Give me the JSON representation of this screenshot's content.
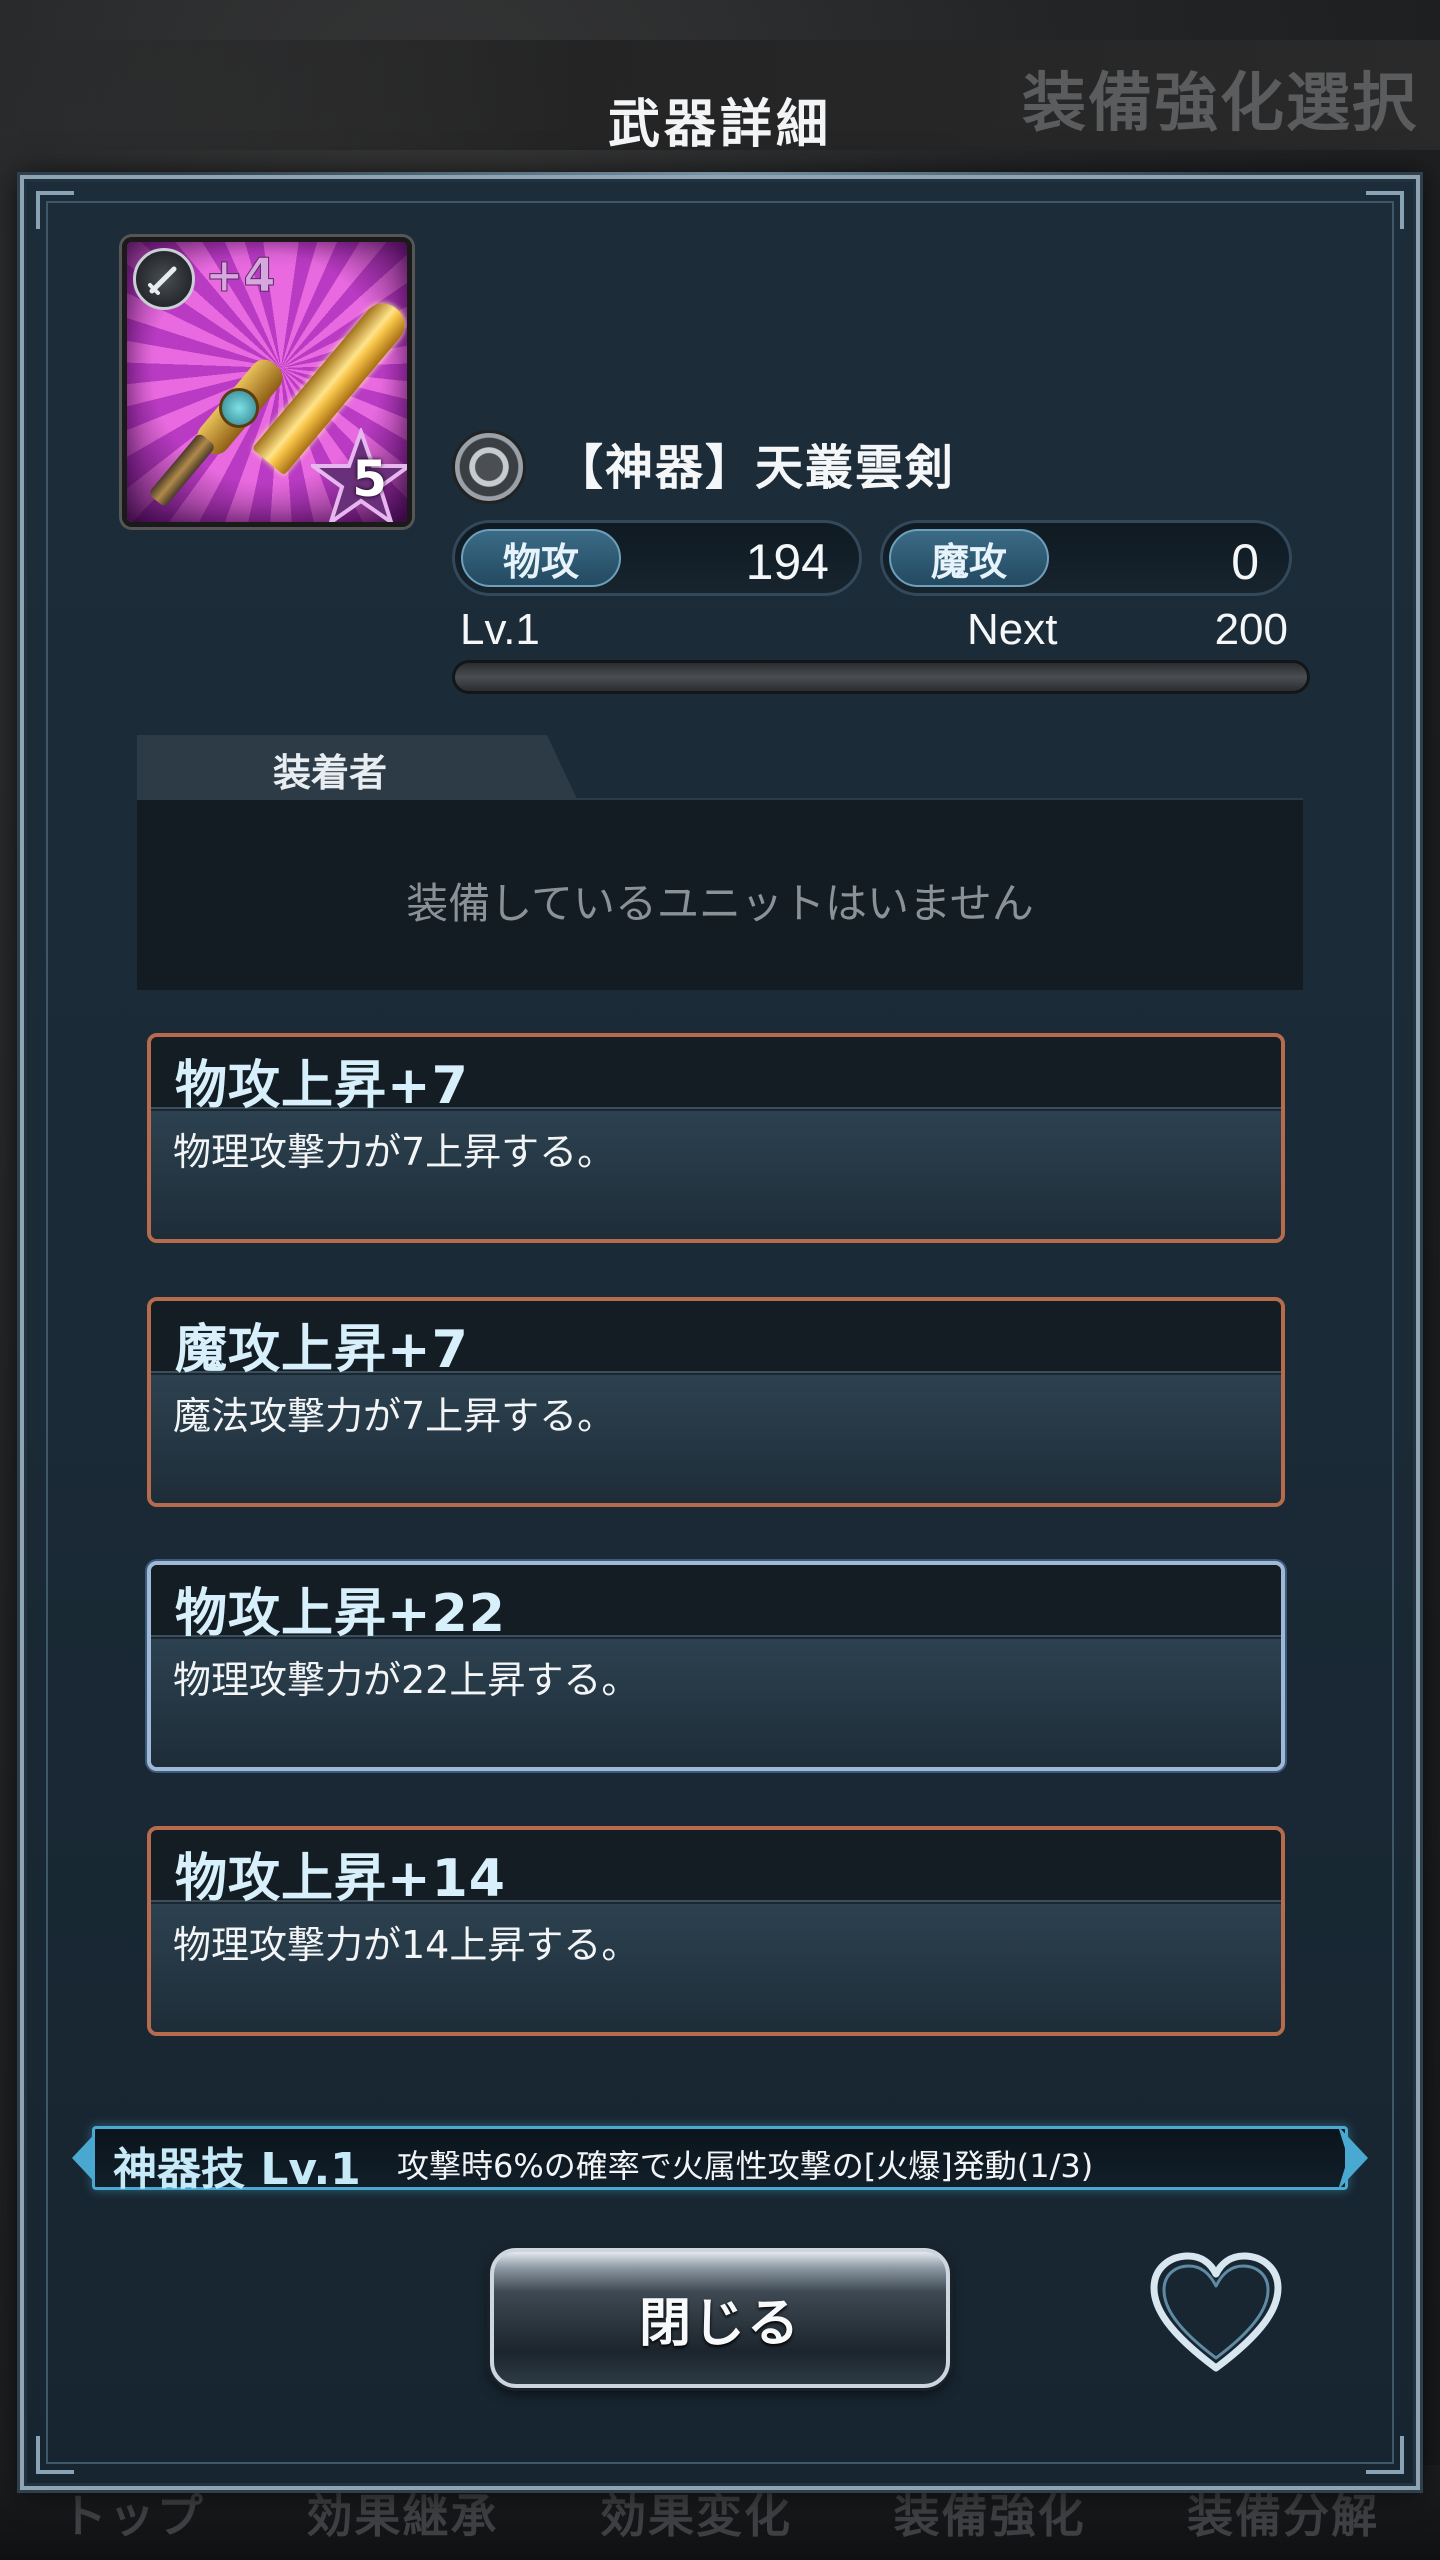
{
  "background": {
    "title": "装備強化選択",
    "nav": [
      "トップ",
      "効果継承",
      "効果変化",
      "装備強化",
      "装備分解"
    ]
  },
  "modal": {
    "title": "武器詳細"
  },
  "weapon": {
    "name": "【神器】天叢雲剣",
    "plus": "+4",
    "rarity": "5",
    "type_icon": "sword-icon",
    "element_icon": "neutral-orb-icon",
    "level": "Lv.1",
    "next_label": "Next",
    "next_value": "200",
    "exp_fraction": 0.0,
    "stats": {
      "phys_label": "物攻",
      "phys_value": "194",
      "mag_label": "魔攻",
      "mag_value": "0"
    }
  },
  "equipper": {
    "tab_label": "装着者",
    "empty_text": "装備しているユニットはいません"
  },
  "effects": [
    {
      "name": "物攻上昇+7",
      "desc": "物理攻撃力が7上昇する。",
      "border": "#b56b4c"
    },
    {
      "name": "魔攻上昇+7",
      "desc": "魔法攻撃力が7上昇する。",
      "border": "#b56b4c"
    },
    {
      "name": "物攻上昇+22",
      "desc": "物理攻撃力が22上昇する。",
      "border": "#9fb9d6"
    },
    {
      "name": "物攻上昇+14",
      "desc": "物理攻撃力が14上昇する。",
      "border": "#b56b4c"
    }
  ],
  "skill": {
    "name": "神器技 Lv.1",
    "desc": "攻撃時6%の確率で火属性攻撃の[火爆]発動(1/3)"
  },
  "buttons": {
    "close_label": "閉じる",
    "favorite_icon": "heart-icon"
  },
  "colors": {
    "accent": "#4aa9d1",
    "effect_border_orange": "#b56b4c",
    "effect_border_blue": "#9fb9d6"
  }
}
